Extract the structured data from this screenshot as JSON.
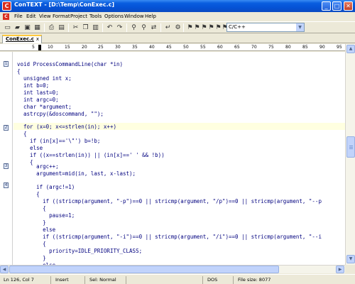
{
  "window": {
    "app_icon_letter": "C",
    "title": "ConTEXT - [D:\\Temp\\ConExec.c]",
    "minimize": "_",
    "maximize": "□",
    "close": "✕"
  },
  "menu": {
    "sys_icon_letter": "C",
    "items": [
      "File",
      "Edit",
      "View",
      "Format",
      "Project",
      "Tools",
      "Options",
      "Window",
      "Help"
    ]
  },
  "toolbar": {
    "icons": [
      "new-file-icon",
      "open-folder-icon",
      "save-icon",
      "save-all-icon",
      "print-icon",
      "print-preview-icon",
      "cut-icon",
      "copy-icon",
      "paste-icon",
      "undo-icon",
      "redo-icon",
      "find-icon",
      "find-next-icon",
      "replace-icon",
      "word-wrap-icon",
      "macro-icon",
      "bookmark-1-icon",
      "bookmark-2-icon",
      "bookmark-3-icon",
      "bookmark-4-icon",
      "bookmark-5-icon",
      "bookmark-6-icon"
    ],
    "language": "C/C++",
    "colors": {
      "accent": "#0A5FE0",
      "bookmark": "#2B3E6B"
    }
  },
  "tab": {
    "label": "ConExec.c",
    "close": "x"
  },
  "ruler": {
    "ticks": [
      "5",
      "10",
      "15",
      "20",
      "25",
      "30",
      "35",
      "40",
      "45",
      "50",
      "55",
      "60",
      "65",
      "70",
      "75",
      "80",
      "85",
      "90",
      "95"
    ]
  },
  "editor": {
    "bookmarks": [
      "1",
      "2",
      "3",
      "4"
    ],
    "lines": [
      "void ProcessCommandLine(char *in)",
      "{",
      "  unsigned int x;",
      "  int b=0;",
      "  int last=0;",
      "  int argc=0;",
      "  char *argument;",
      "",
      "  astrcpy(&doscommand, \"\");",
      "",
      "  for (x=0; x<=strlen(in); x++)",
      "  {",
      "    if (in[x]=='\\\"') b=!b;",
      "    else",
      "    if ((x==strlen(in)) || (in[x]==' ' && !b))",
      "    {",
      "      argc++;",
      "      argument=mid(in, last, x-last);",
      "",
      "      if (argc!=1)",
      "      {",
      "        if ((stricmp(argument, \"-p\")==0 || stricmp(argument, \"/p\")==0 || stricmp(argument, \"--p",
      "        {",
      "          pause=1;",
      "        }",
      "        else",
      "        if ((stricmp(argument, \"-i\")==0 || stricmp(argument, \"/i\")==0 || stricmp(argument, \"--i",
      "        {",
      "          priority=IDLE_PRIORITY_CLASS;",
      "        }",
      "        else",
      "        {"
    ]
  },
  "status": {
    "position": "Ln 126, Col 7",
    "mode": "Insert",
    "selection": "Sel: Normal",
    "extra": "",
    "line_ending": "DOS",
    "file_size": "File size: 8077"
  }
}
